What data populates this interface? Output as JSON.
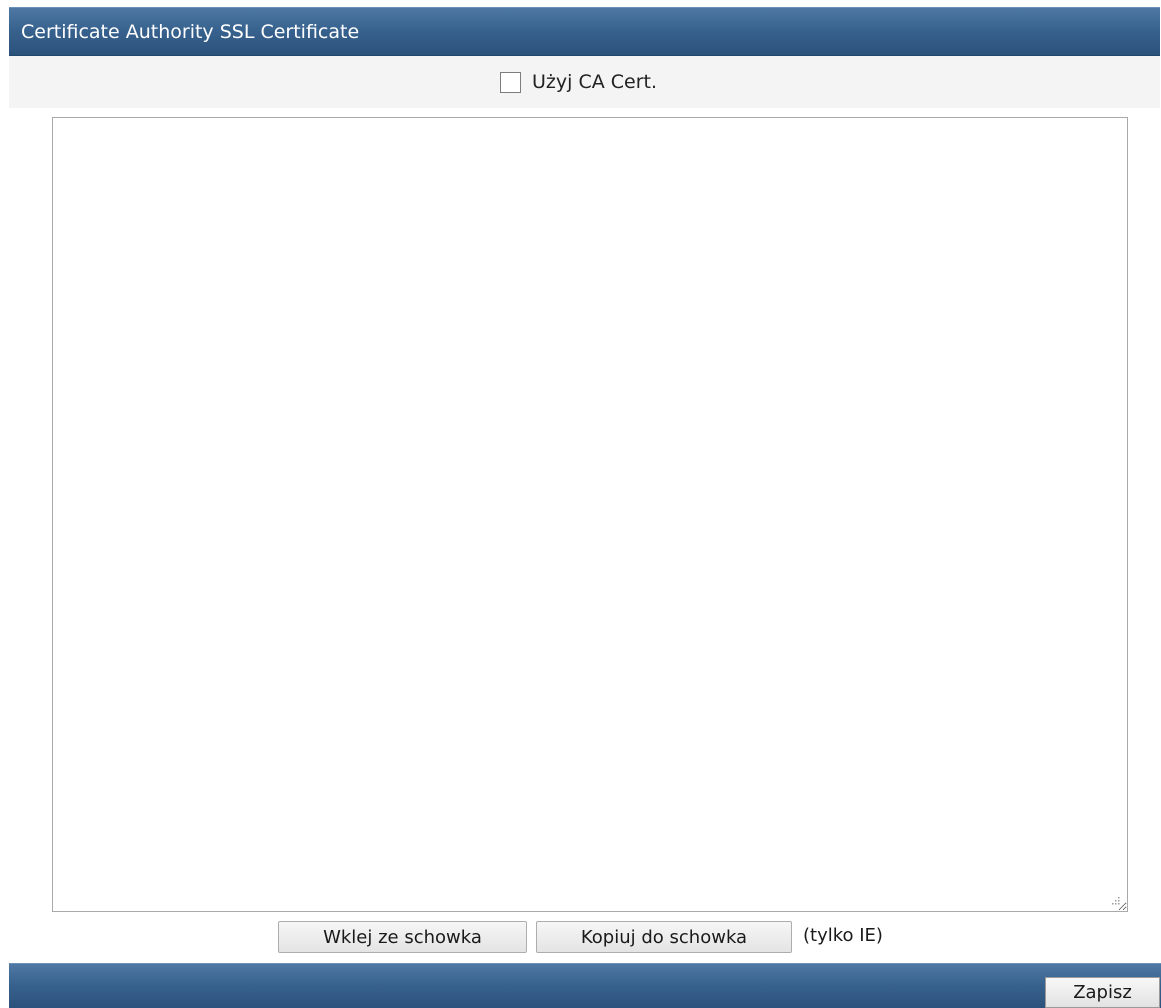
{
  "header": {
    "title": "Certificate Authority SSL Certificate"
  },
  "ca_toggle": {
    "label": "Użyj CA Cert.",
    "checked": false
  },
  "certificate": {
    "value": ""
  },
  "clipboard": {
    "paste_label": "Wklej ze schowka",
    "copy_label": "Kopiuj do schowka",
    "note": "(tylko IE)"
  },
  "footer": {
    "save_label": "Zapisz"
  },
  "colors": {
    "header_bar": "#37618d",
    "row_background": "#f4f4f4",
    "textarea_border": "#a9a9a9"
  },
  "icons": {
    "checkbox": "checkbox-unchecked-icon",
    "resize_grip": "resize-grip-icon"
  }
}
